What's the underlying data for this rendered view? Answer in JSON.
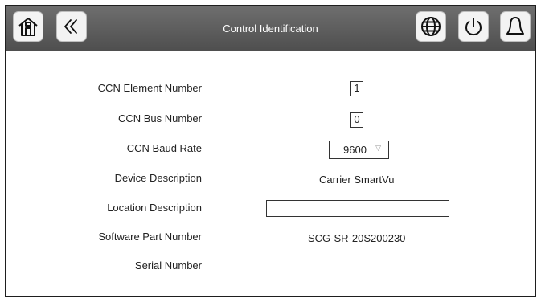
{
  "header": {
    "title": "Control Identification",
    "icons": [
      "home-icon",
      "back-chevron-icon",
      "globe-icon",
      "power-icon",
      "bell-icon"
    ]
  },
  "fields": {
    "ccn_element_number": {
      "label": "CCN Element Number",
      "value": "1"
    },
    "ccn_bus_number": {
      "label": "CCN Bus Number",
      "value": "0"
    },
    "ccn_baud_rate": {
      "label": "CCN Baud Rate",
      "value": "9600",
      "arrow": "▽"
    },
    "device_description": {
      "label": "Device Description",
      "value": "Carrier SmartVu"
    },
    "location_description": {
      "label": "Location Description",
      "value": ""
    },
    "software_part_number": {
      "label": "Software Part Number",
      "value": "SCG-SR-20S200230"
    },
    "serial_number": {
      "label": "Serial Number",
      "value": ""
    }
  },
  "colors": {
    "header_bg": "#5a5a5a",
    "button_bg": "#f3f3f3",
    "border": "#1e1e1e"
  }
}
